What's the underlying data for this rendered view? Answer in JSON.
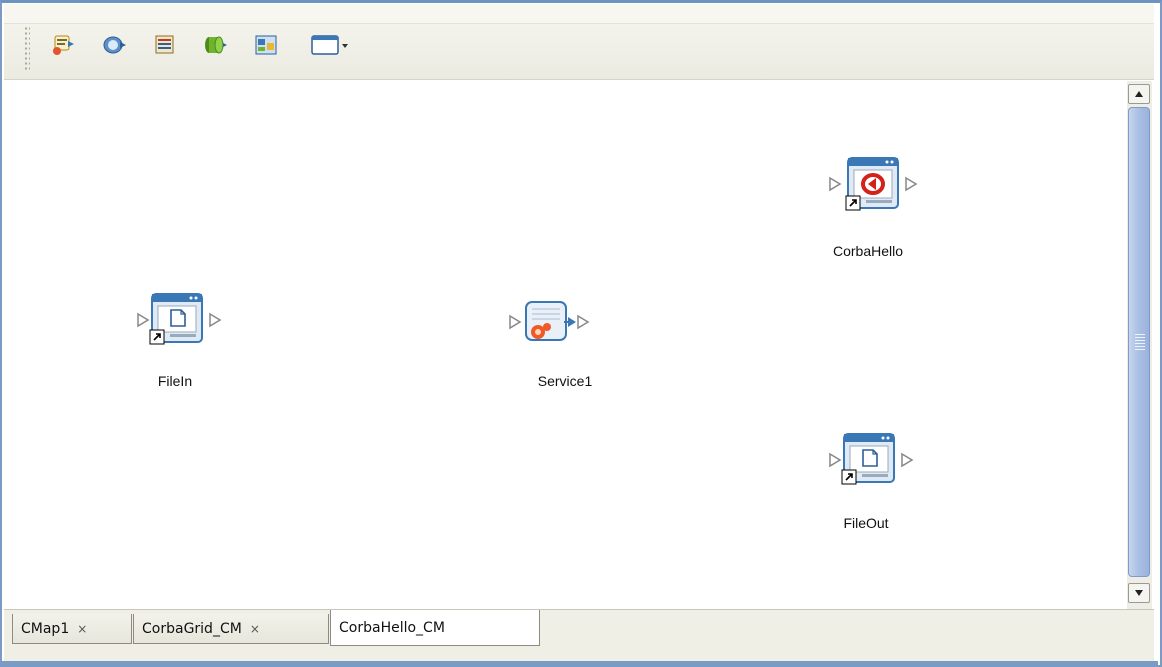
{
  "toolbar": {
    "buttons": [
      {
        "icon": "external-application-icon"
      },
      {
        "icon": "service-icon"
      },
      {
        "icon": "web-service-icon"
      },
      {
        "icon": "queue-icon"
      },
      {
        "icon": "business-process-icon"
      },
      {
        "icon": "window-dropdown-icon"
      }
    ]
  },
  "canvas": {
    "components": [
      {
        "id": "filein",
        "label": "FileIn",
        "type": "file-external"
      },
      {
        "id": "service1",
        "label": "Service1",
        "type": "service"
      },
      {
        "id": "corbahello",
        "label": "CorbaHello",
        "type": "corba-external"
      },
      {
        "id": "fileout",
        "label": "FileOut",
        "type": "file-external"
      }
    ]
  },
  "tabs": [
    {
      "label": "CMap1",
      "close": "×",
      "active": false
    },
    {
      "label": "CorbaGrid_CM",
      "close": "×",
      "active": false
    },
    {
      "label": "CorbaHello_CM",
      "active": true
    }
  ],
  "colors": {
    "frame_border": "#7a9cc4",
    "scroll_thumb": "#a9bfe4",
    "icon_blue": "#3a78b5"
  }
}
